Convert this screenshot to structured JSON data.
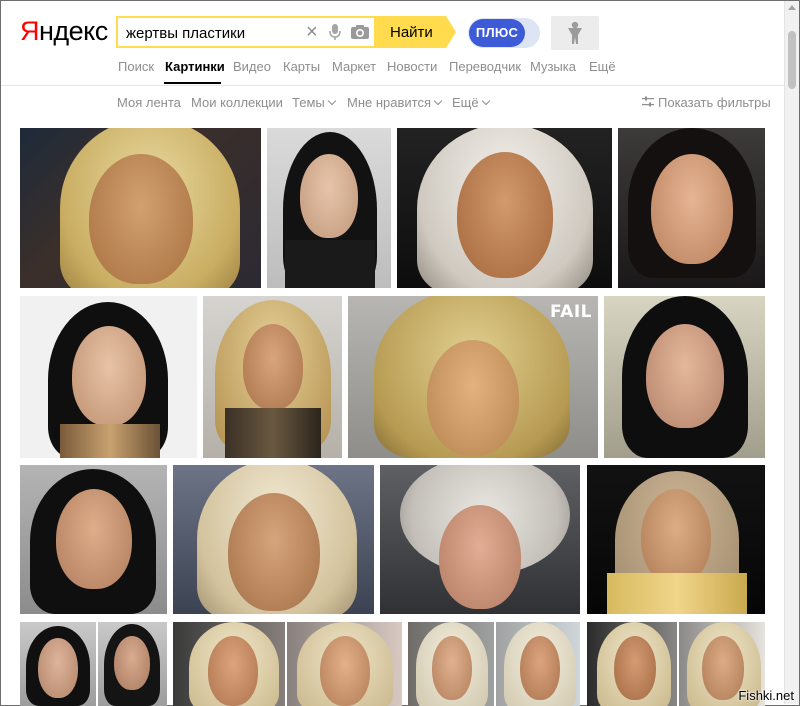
{
  "logo": "Яндекс",
  "search": {
    "query": "жертвы пластики",
    "button_label": "Найти"
  },
  "plus_label": "ПЛЮС",
  "services": [
    "Поиск",
    "Картинки",
    "Видео",
    "Карты",
    "Маркет",
    "Новости",
    "Переводчик",
    "Музыка",
    "Ещё"
  ],
  "active_service": "Картинки",
  "subnav": {
    "feed": "Моя лента",
    "collections": "Мои коллекции",
    "themes": "Темы",
    "likes": "Мне нравится",
    "more": "Ещё"
  },
  "filters_label": "Показать фильтры",
  "fail_label": "FAIL",
  "watermark": "Fishki.net",
  "icons": [
    "clear-icon",
    "microphone-icon",
    "camera-icon",
    "filters-icon",
    "user-icon"
  ],
  "colors": {
    "accent": "#ffdb4d",
    "plus": "#3d5bd6",
    "logo_red": "#ff0000",
    "muted_text": "#8e8e8e"
  }
}
